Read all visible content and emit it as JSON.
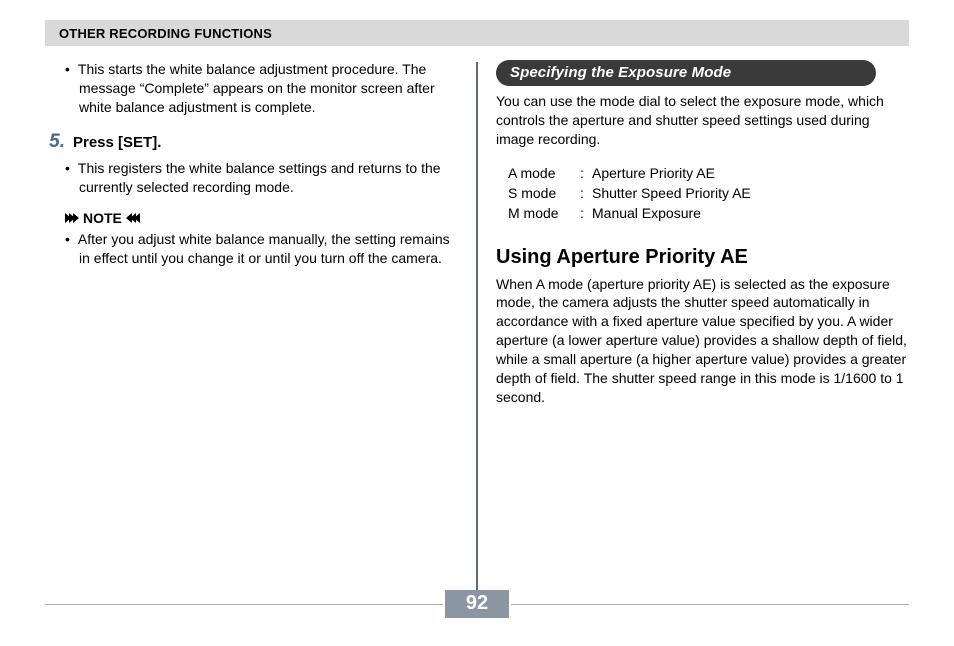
{
  "header": {
    "title": "OTHER RECORDING FUNCTIONS"
  },
  "left": {
    "bullet1": "This starts the white balance adjustment procedure. The message “Complete” appears on the monitor screen after white balance adjustment is complete.",
    "step": {
      "num": "5.",
      "text": "Press [SET]."
    },
    "bullet2": "This registers the white balance settings and returns to the currently selected recording mode.",
    "note_label": "NOTE",
    "note_bullet": "After you adjust white balance manually, the setting remains in effect until you change it or until you turn off the camera."
  },
  "right": {
    "pill": "Specifying the Exposure Mode",
    "intro": "You can use the mode dial to select the exposure mode, which controls the aperture and shutter speed settings used during image recording.",
    "modes": [
      {
        "key": "A mode",
        "val": "Aperture Priority AE"
      },
      {
        "key": "S mode",
        "val": "Shutter Speed Priority AE"
      },
      {
        "key": "M mode",
        "val": "Manual Exposure"
      }
    ],
    "sub_heading": "Using Aperture Priority AE",
    "sub_para": "When A mode (aperture priority AE) is selected as the exposure mode, the camera adjusts the shutter speed automatically in accordance with a fixed aperture value specified by you. A wider aperture (a lower aperture value) provides a shallow depth of field, while a small aperture (a higher aperture value) provides a greater depth of field. The shutter speed range in this mode is 1/1600 to 1 second."
  },
  "page_number": "92"
}
